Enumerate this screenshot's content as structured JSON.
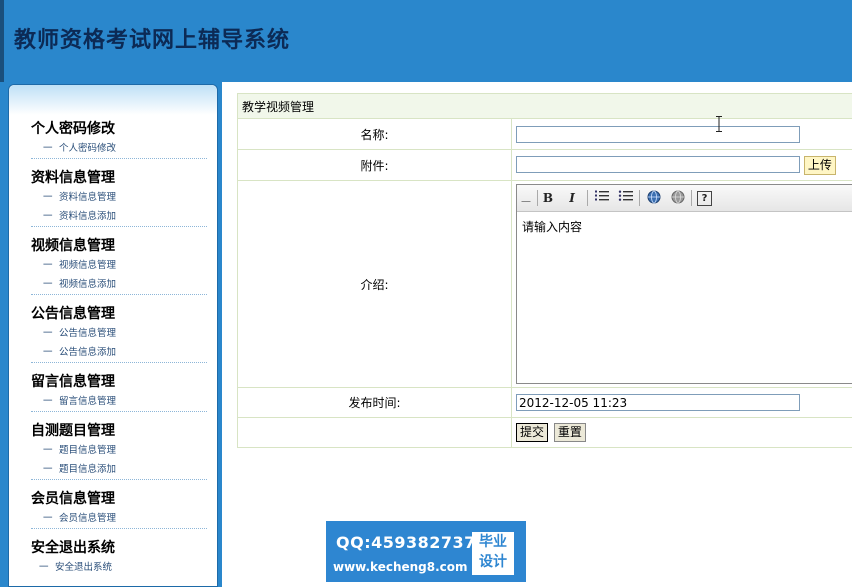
{
  "header": {
    "title": "教师资格考试网上辅导系统"
  },
  "sidebar": {
    "dash": "一",
    "groups": [
      {
        "title": "个人密码修改",
        "items": [
          "个人密码修改"
        ]
      },
      {
        "title": "资料信息管理",
        "items": [
          "资料信息管理",
          "资料信息添加"
        ]
      },
      {
        "title": "视频信息管理",
        "items": [
          "视频信息管理",
          "视频信息添加"
        ]
      },
      {
        "title": "公告信息管理",
        "items": [
          "公告信息管理",
          "公告信息添加"
        ]
      },
      {
        "title": "留言信息管理",
        "items": [
          "留言信息管理"
        ]
      },
      {
        "title": "自测题目管理",
        "items": [
          "题目信息管理",
          "题目信息添加"
        ]
      },
      {
        "title": "会员信息管理",
        "items": [
          "会员信息管理"
        ]
      },
      {
        "title": "安全退出系统",
        "items": [
          "安全退出系统"
        ]
      }
    ]
  },
  "form": {
    "caption": "教学视频管理",
    "name_label": "名称:",
    "name_value": "",
    "attachment_label": "附件:",
    "attachment_value": "",
    "upload_label": "上传",
    "intro_label": "介绍:",
    "editor": {
      "content": "请输入内容",
      "toolbar": [
        "source-icon",
        "bold-icon",
        "italic-icon",
        "ordered-list-icon",
        "unordered-list-icon",
        "link-icon",
        "unlink-icon",
        "help-icon"
      ],
      "bold_glyph": "B",
      "italic_glyph": "I",
      "help_glyph": "?"
    },
    "publish_label": "发布时间:",
    "publish_value": "2012-12-05 11:23",
    "submit_label": "提交",
    "reset_label": "重置"
  },
  "watermark": {
    "qq": "QQ:459382737",
    "url": "www.kecheng8.com",
    "badge_line1": "毕业",
    "badge_line2": "设计"
  }
}
